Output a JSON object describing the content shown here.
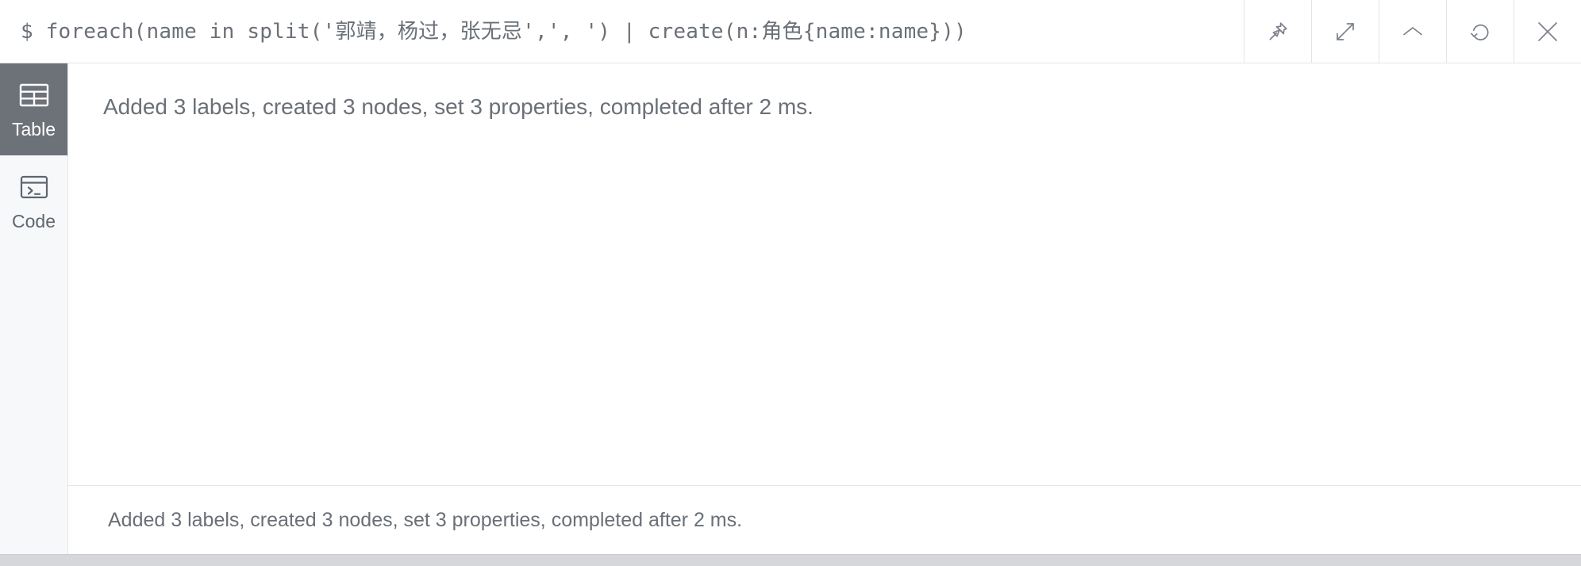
{
  "editor": {
    "prompt": "$",
    "command": "foreach(name in split('郭靖，杨过，张无忌',', ') | create(n:角色{name:name}))",
    "full_line": "$ foreach(name in split('郭靖，杨过，张无忌',', ') | create(n:角色{name:name}))"
  },
  "toolbar": {
    "buttons": [
      {
        "name": "pin-icon",
        "label": "Pin"
      },
      {
        "name": "expand-icon",
        "label": "Expand"
      },
      {
        "name": "chevron-up-icon",
        "label": "Collapse"
      },
      {
        "name": "refresh-icon",
        "label": "Rerun"
      },
      {
        "name": "close-icon",
        "label": "Close"
      }
    ]
  },
  "sidebar": {
    "items": [
      {
        "label": "Table",
        "icon": "table-icon",
        "active": true
      },
      {
        "label": "Code",
        "icon": "code-icon",
        "active": false
      }
    ]
  },
  "result": {
    "message": "Added 3 labels, created 3 nodes, set 3 properties, completed after 2 ms."
  },
  "status": {
    "message": "Added 3 labels, created 3 nodes, set 3 properties, completed after 2 ms."
  },
  "colors": {
    "page_background": "#d6d7db",
    "panel_background": "#ffffff",
    "sidebar_background": "#f7f8fa",
    "sidebar_active_background": "#6d7278",
    "text": "#6a7077",
    "border": "#e3e5e8"
  }
}
